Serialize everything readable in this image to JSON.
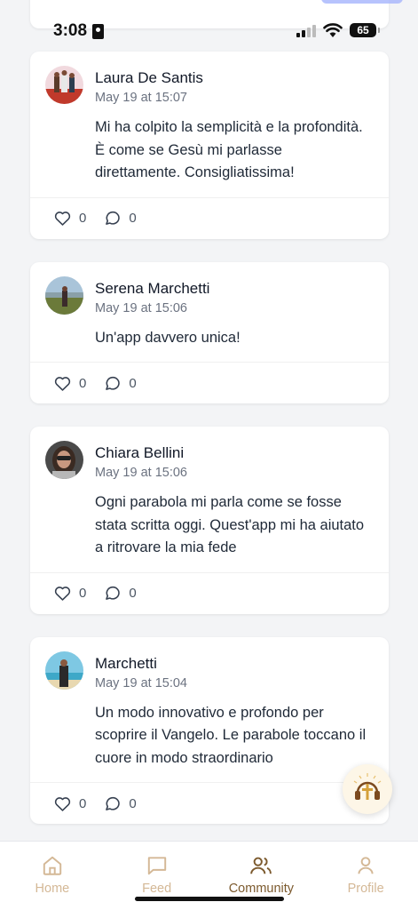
{
  "status_bar": {
    "time": "3:08",
    "battery": "65"
  },
  "posts": [
    {
      "author": "Laura De Santis",
      "date": "May 19 at 15:07",
      "text": "Mi ha colpito la semplicità e la profondità. È come se Gesù mi parlasse direttamente. Consigliatissima!",
      "likes": "0",
      "comments": "0"
    },
    {
      "author": "Serena Marchetti",
      "date": "May 19 at 15:06",
      "text": "Un'app davvero unica!",
      "likes": "0",
      "comments": "0"
    },
    {
      "author": "Chiara Bellini",
      "date": "May 19 at 15:06",
      "text": "Ogni parabola mi parla come se fosse stata scritta oggi. Quest'app mi ha aiutato a ritrovare la mia fede",
      "likes": "0",
      "comments": "0"
    },
    {
      "author": "Marchetti",
      "date": "May 19 at 15:04",
      "text": "Un modo innovativo e profondo per scoprire il Vangelo. Le parabole toccano il cuore in modo straordinario",
      "likes": "0",
      "comments": "0"
    }
  ],
  "tabs": [
    {
      "label": "Home",
      "icon": "home-icon"
    },
    {
      "label": "Feed",
      "icon": "chat-icon"
    },
    {
      "label": "Community",
      "icon": "users-icon",
      "active": true
    },
    {
      "label": "Profile",
      "icon": "user-icon"
    }
  ],
  "colors": {
    "accent_active": "#7c5a2e",
    "accent_inactive": "#d4b896",
    "background": "#f3f4f6"
  }
}
